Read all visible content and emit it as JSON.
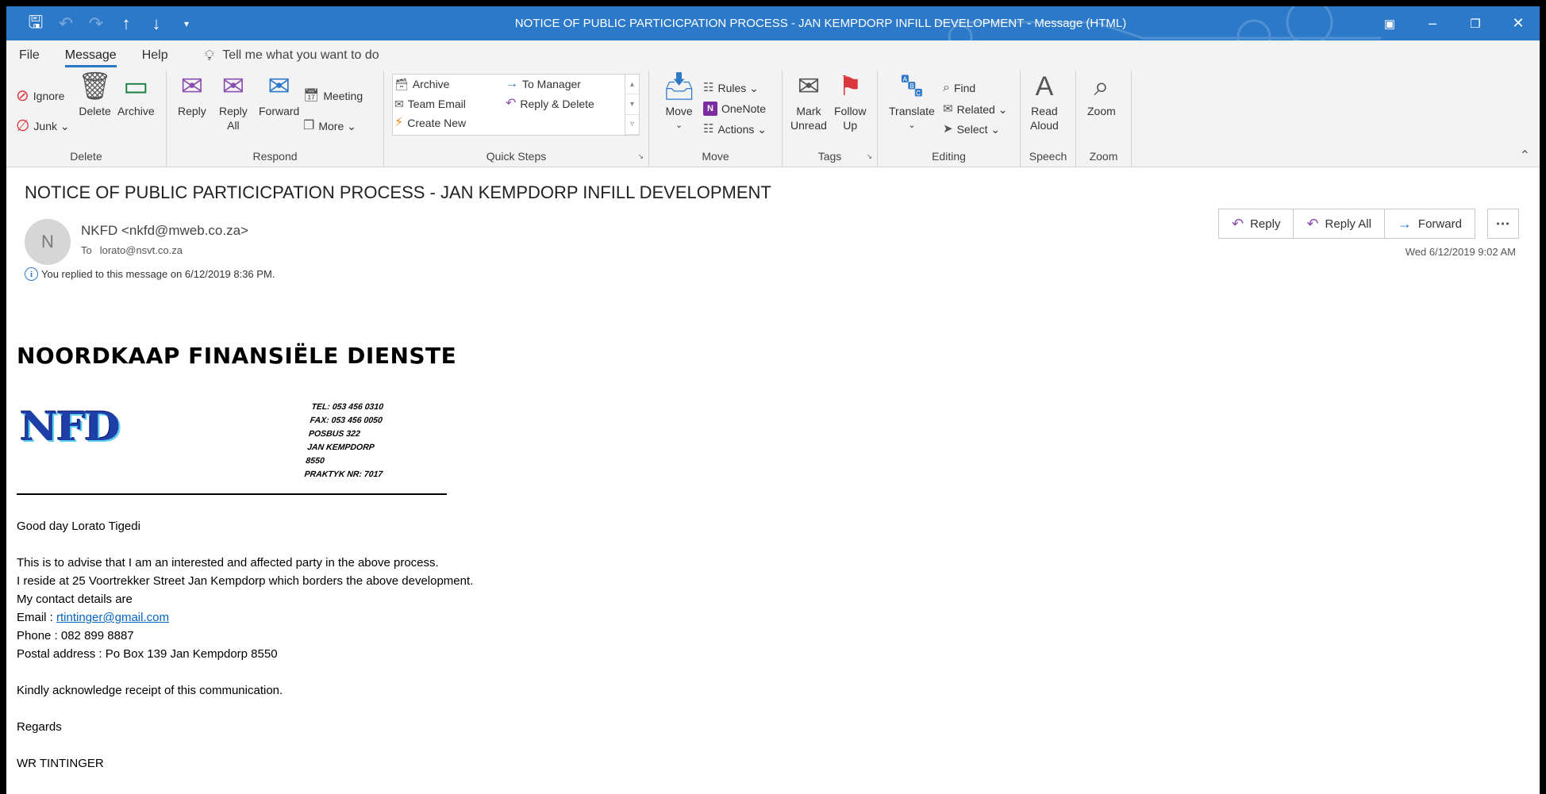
{
  "window": {
    "title": "NOTICE OF PUBLIC PARTICICPATION PROCESS - JAN KEMPDORP INFILL DEVELOPMENT  -  Message (HTML)"
  },
  "menu": {
    "tabs": [
      "File",
      "Message",
      "Help"
    ],
    "tell_me": "Tell me what you want to do"
  },
  "ribbon": {
    "delete": {
      "label": "Delete",
      "ignore": "Ignore",
      "junk": "Junk",
      "delete": "Delete",
      "archive": "Archive"
    },
    "respond": {
      "label": "Respond",
      "reply": "Reply",
      "reply_all_1": "Reply",
      "reply_all_2": "All",
      "forward": "Forward",
      "meeting": "Meeting",
      "more": "More"
    },
    "quick_steps": {
      "label": "Quick Steps",
      "archive": "Archive",
      "team_email": "Team Email",
      "create_new": "Create New",
      "to_manager": "To Manager",
      "reply_delete": "Reply & Delete"
    },
    "move": {
      "label": "Move",
      "move": "Move",
      "rules": "Rules",
      "onenote": "OneNote",
      "actions": "Actions"
    },
    "tags": {
      "label": "Tags",
      "mark_1": "Mark",
      "mark_2": "Unread",
      "follow_1": "Follow",
      "follow_2": "Up"
    },
    "editing": {
      "label": "Editing",
      "translate": "Translate",
      "find": "Find",
      "related": "Related",
      "select": "Select"
    },
    "speech": {
      "label": "Speech",
      "read_1": "Read",
      "read_2": "Aloud"
    },
    "zoom": {
      "label": "Zoom",
      "zoom": "Zoom"
    }
  },
  "message": {
    "subject": "NOTICE OF PUBLIC PARTICICPATION PROCESS - JAN KEMPDORP INFILL DEVELOPMENT",
    "avatar_initial": "N",
    "sender": "NKFD <nkfd@mweb.co.za>",
    "to_label": "To",
    "to": "lorato@nsvt.co.za",
    "info": "You replied to this message on 6/12/2019 8:36 PM.",
    "datetime": "Wed 6/12/2019 9:02 AM",
    "actions": {
      "reply": "Reply",
      "reply_all": "Reply All",
      "forward": "Forward"
    }
  },
  "body": {
    "org_name": "NOORDKAAP FINANSIËLE DIENSTE",
    "logo_text": "NFD",
    "address_lines": [
      "TEL: 053 456 0310",
      "FAX: 053 456 0050",
      "POSBUS 322",
      "JAN KEMPDORP",
      "8550",
      "PRAKTYK NR: 7017"
    ],
    "greeting": "Good day Lorato Tigedi",
    "line1": "This is to advise that I am an interested and affected party in the above process.",
    "line2": "I reside at 25 Voortrekker Street Jan Kempdorp which borders the above development.",
    "line3": "My contact details are",
    "email_label": "Email : ",
    "email": "rtintinger@gmail.com",
    "phone": "Phone : 082 899 8887",
    "postal": "Postal address : Po Box 139 Jan Kempdorp  8550",
    "ack": "Kindly acknowledge receipt of this communication.",
    "regards": "Regards",
    "signature": "WR TINTINGER"
  }
}
